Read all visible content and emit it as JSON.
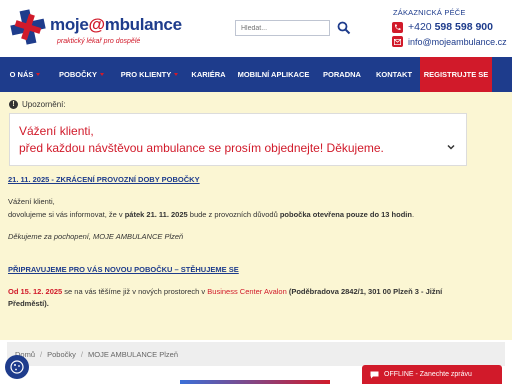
{
  "header": {
    "logo_main": "moje",
    "logo_at": "@",
    "logo_rest": "mbulance",
    "logo_sub": "praktický lékař pro dospělé",
    "search_placeholder": "Hledat...",
    "care_title": "ZÁKAZNICKÁ PÉČE",
    "phone_prefix": "+420",
    "phone_number": "598 598 900",
    "email": "info@mojeambulance.cz"
  },
  "nav": {
    "items": [
      {
        "label": "O NÁS"
      },
      {
        "label": "POBOČKY"
      },
      {
        "label": "PRO KLIENTY"
      },
      {
        "label": "KARIÉRA"
      },
      {
        "label": "MOBILNÍ APLIKACE"
      },
      {
        "label": "PORADNA"
      },
      {
        "label": "KONTAKT"
      },
      {
        "label": "REGISTRUJTE SE"
      }
    ]
  },
  "notice": {
    "heading": "Upozornění:",
    "alert_line1": "Vážení klienti,",
    "alert_line2": "před každou návštěvou ambulance se prosím objednejte! Děkujeme.",
    "news1_title": "21. 11. 2025 - ZKRÁCENÍ PROVOZNÍ DOBY POBOČKY",
    "news1_greeting": "Vážení klienti,",
    "news1_p1": "dovolujeme si vás informovat, že v ",
    "news1_date": "pátek 21. 11. 2025",
    "news1_p2": " bude z provozních důvodů ",
    "news1_highlight": "pobočka otevřena pouze do 13 hodin",
    "news1_p3": ".",
    "news1_thanks": "Děkujeme za pochopení, MOJE AMBULANCE Plzeň",
    "news2_title": "PŘIPRAVUJEME PRO VÁS NOVOU POBOČKU – STĚHUJEME SE",
    "news2_date": "Od 15. 12. 2025",
    "news2_p1": " se na vás těšíme již v nových prostorech v ",
    "news2_place": "Business Center Avalon",
    "news2_addr1": " (Poděbradova 2842/1, 301 00 Plzeň 3 - Jižní",
    "news2_addr2": "Předměstí)."
  },
  "breadcrumb": {
    "items": [
      "Domů",
      "Pobočky",
      "MOJE AMBULANCE Plzeň"
    ],
    "separator": "/"
  },
  "chat": {
    "label": "OFFLINE - Zanechte zprávu"
  },
  "colors": {
    "brand_blue": "#1e3c8c",
    "brand_red": "#d11a2a",
    "notice_bg": "#fbf6d3"
  }
}
